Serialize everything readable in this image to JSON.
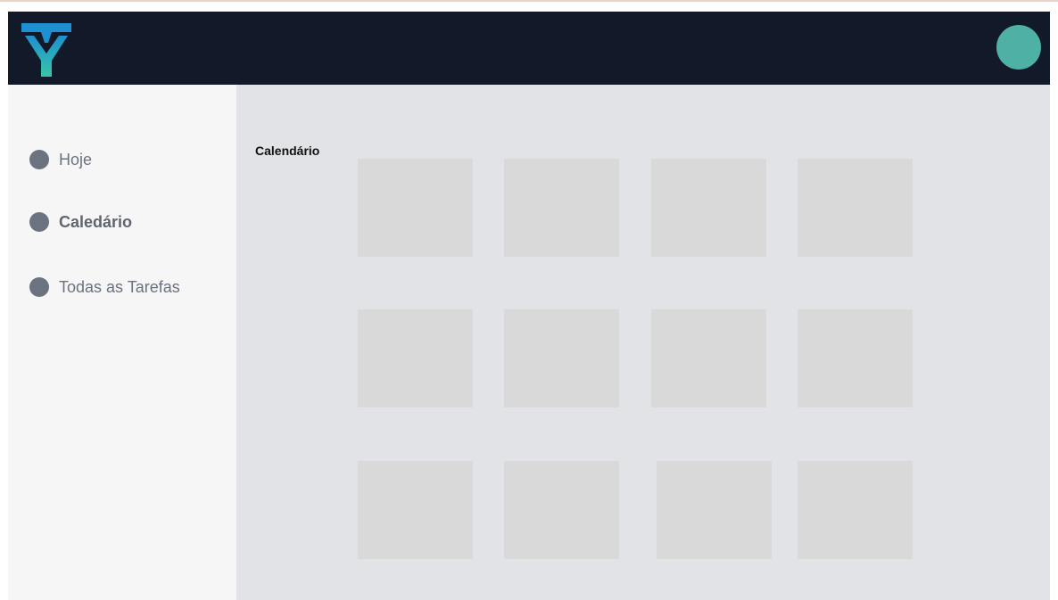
{
  "header": {
    "logo": "ty-logo-icon",
    "avatar": "user-avatar",
    "colors": {
      "background": "#121a29",
      "avatar": "#4fb0a5",
      "logo_top": "#1e8fd0",
      "logo_bottom": "#37c6a8"
    }
  },
  "sidebar": {
    "items": [
      {
        "label": "Hoje",
        "active": false
      },
      {
        "label": "Caledário",
        "active": true
      },
      {
        "label": "Todas as Tarefas",
        "active": false
      }
    ]
  },
  "main": {
    "title": "Calendário",
    "grid": {
      "rows": 3,
      "columns": 4,
      "cell_color": "#d9d9d9"
    }
  }
}
